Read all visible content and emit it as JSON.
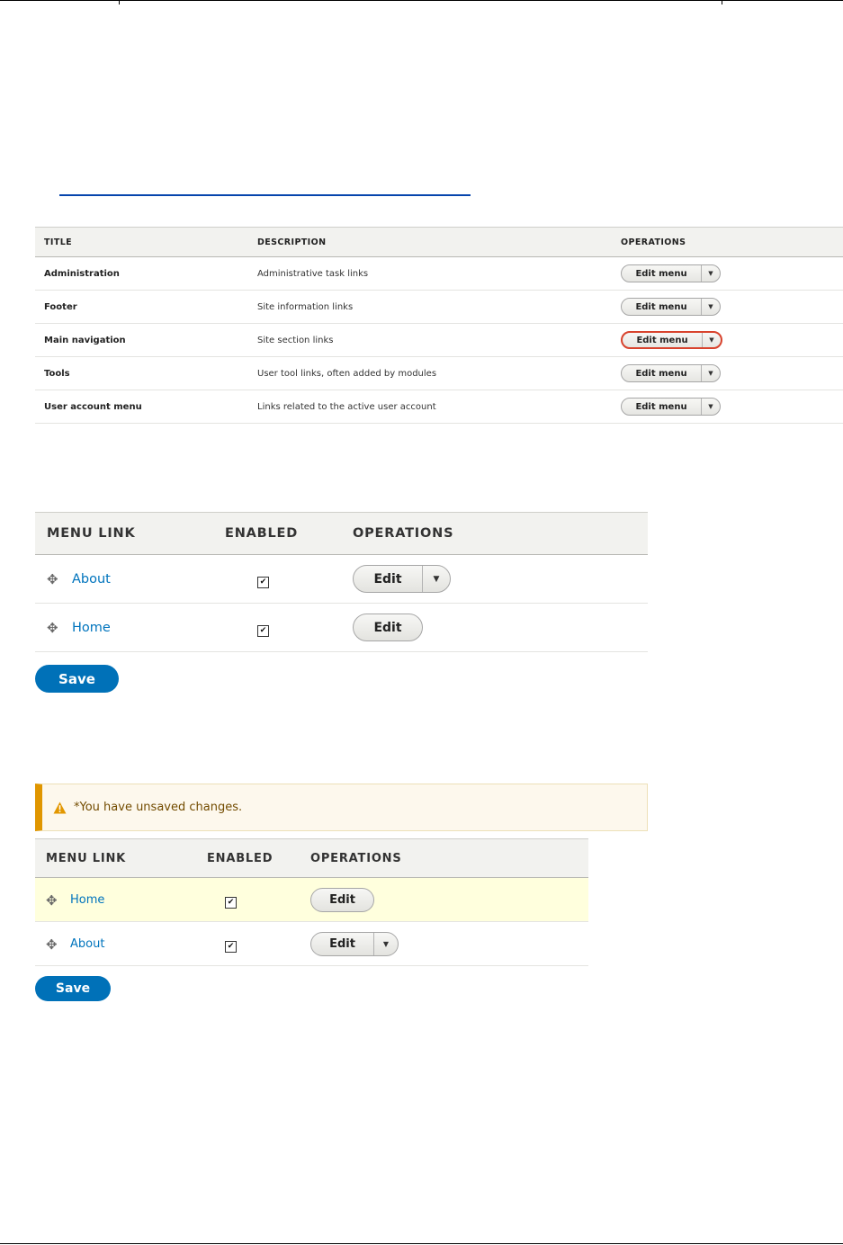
{
  "menus_table": {
    "headers": {
      "title": "TITLE",
      "description": "DESCRIPTION",
      "operations": "OPERATIONS"
    },
    "rows": [
      {
        "title": "Administration",
        "description": "Administrative task links",
        "button": "Edit menu"
      },
      {
        "title": "Footer",
        "description": "Site information links",
        "button": "Edit menu"
      },
      {
        "title": "Main navigation",
        "description": "Site section links",
        "button": "Edit menu"
      },
      {
        "title": "Tools",
        "description": "User tool links, often added by modules",
        "button": "Edit menu"
      },
      {
        "title": "User account menu",
        "description": "Links related to the active user account",
        "button": "Edit menu"
      }
    ]
  },
  "links_before": {
    "headers": {
      "menu_link": "MENU LINK",
      "enabled": "ENABLED",
      "operations": "OPERATIONS"
    },
    "rows": [
      {
        "label": "About",
        "enabled": "✔",
        "button": "Edit"
      },
      {
        "label": "Home",
        "enabled": "✔",
        "button": "Edit"
      }
    ],
    "save_label": "Save"
  },
  "links_after": {
    "warning": "*You have unsaved changes.",
    "headers": {
      "menu_link": "MENU LINK",
      "enabled": "ENABLED",
      "operations": "OPERATIONS"
    },
    "rows": [
      {
        "label": "Home",
        "enabled": "✔",
        "button": "Edit"
      },
      {
        "label": "About",
        "enabled": "✔",
        "button": "Edit"
      }
    ],
    "save_label": "Save"
  },
  "colors": {
    "link": "#0074bd",
    "primary_button": "#0071b8",
    "focus_outline": "#d8432d",
    "warning_accent": "#e09600",
    "row_highlight": "#ffffdd"
  },
  "icons": {
    "drag_handle": "drag-handle-icon",
    "dropdown": "chevron-down-icon",
    "warning": "warning-icon"
  }
}
